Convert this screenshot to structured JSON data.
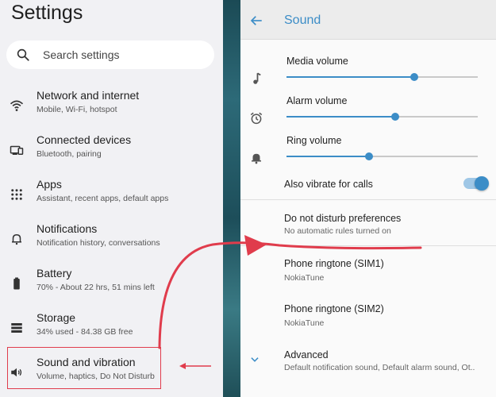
{
  "settings": {
    "title": "Settings",
    "search_placeholder": "Search settings",
    "items": [
      {
        "title": "Network and internet",
        "subtitle": "Mobile, Wi-Fi, hotspot",
        "icon": "wifi-icon"
      },
      {
        "title": "Connected devices",
        "subtitle": "Bluetooth, pairing",
        "icon": "devices-icon"
      },
      {
        "title": "Apps",
        "subtitle": "Assistant, recent apps, default apps",
        "icon": "apps-grid-icon"
      },
      {
        "title": "Notifications",
        "subtitle": "Notification history, conversations",
        "icon": "bell-icon"
      },
      {
        "title": "Battery",
        "subtitle": "70% - About 22 hrs, 51 mins left",
        "icon": "battery-icon"
      },
      {
        "title": "Storage",
        "subtitle": "34% used - 84.38 GB free",
        "icon": "storage-icon"
      },
      {
        "title": "Sound and vibration",
        "subtitle": "Volume, haptics, Do Not Disturb",
        "icon": "speaker-icon"
      }
    ]
  },
  "sound": {
    "title": "Sound",
    "volumes": [
      {
        "label": "Media volume",
        "level": 0.67,
        "icon": "music-note-icon"
      },
      {
        "label": "Alarm volume",
        "level": 0.57,
        "icon": "alarm-clock-icon"
      },
      {
        "label": "Ring volume",
        "level": 0.43,
        "icon": "bell-icon"
      }
    ],
    "vibrate_label": "Also vibrate for calls",
    "vibrate_on": true,
    "dnd": {
      "title": "Do not disturb preferences",
      "subtitle": "No automatic rules turned on"
    },
    "ringtone1": {
      "title": "Phone ringtone (SIM1)",
      "subtitle": "NokiaTune"
    },
    "ringtone2": {
      "title": "Phone ringtone (SIM2)",
      "subtitle": "NokiaTune"
    },
    "advanced": {
      "title": "Advanced",
      "subtitle": "Default notification sound, Default alarm sound, Ot.."
    }
  },
  "colors": {
    "accent": "#3c8dc7",
    "annotation": "#e03c4c",
    "left_bg": "#f1f1f4"
  }
}
